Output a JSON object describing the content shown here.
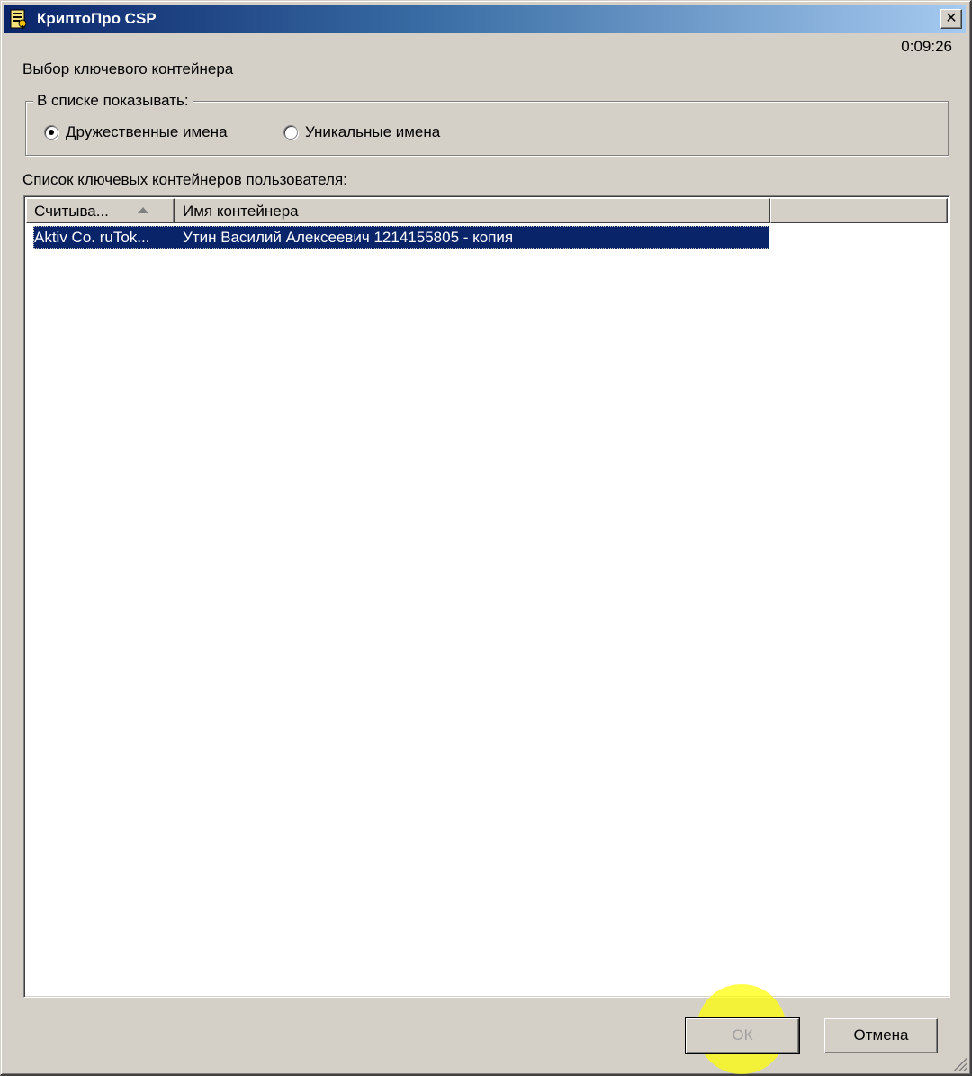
{
  "window": {
    "title": "КриптоПро CSP",
    "close_symbol": "✕",
    "timer": "0:09:26"
  },
  "dialog": {
    "subtitle": "Выбор ключевого контейнера",
    "show_group": {
      "legend": "В списке показывать:",
      "options": [
        {
          "label": "Дружественные имена",
          "checked": true
        },
        {
          "label": "Уникальные имена",
          "checked": false
        }
      ]
    },
    "list_label": "Список ключевых контейнеров пользователя:",
    "list": {
      "columns": [
        "Считыва...",
        "Имя контейнера"
      ],
      "sort_column": "Считыва...",
      "rows": [
        {
          "reader": "Aktiv Co. ruTok...",
          "container": "Утин Василий Алексеевич 1214155805 - копия",
          "selected": true
        }
      ]
    },
    "buttons": {
      "ok": "ОК",
      "cancel": "Отмена"
    }
  },
  "colors": {
    "title_gradient_start": "#0a246a",
    "title_gradient_end": "#a6caf0",
    "selection": "#0a246a",
    "face": "#d4d0c8",
    "cursor_highlight": "#ffff00"
  },
  "icons": {
    "app": "key-certificate-icon",
    "close": "close-icon",
    "sort": "sort-ascending-icon",
    "resize": "resize-grip-icon"
  }
}
